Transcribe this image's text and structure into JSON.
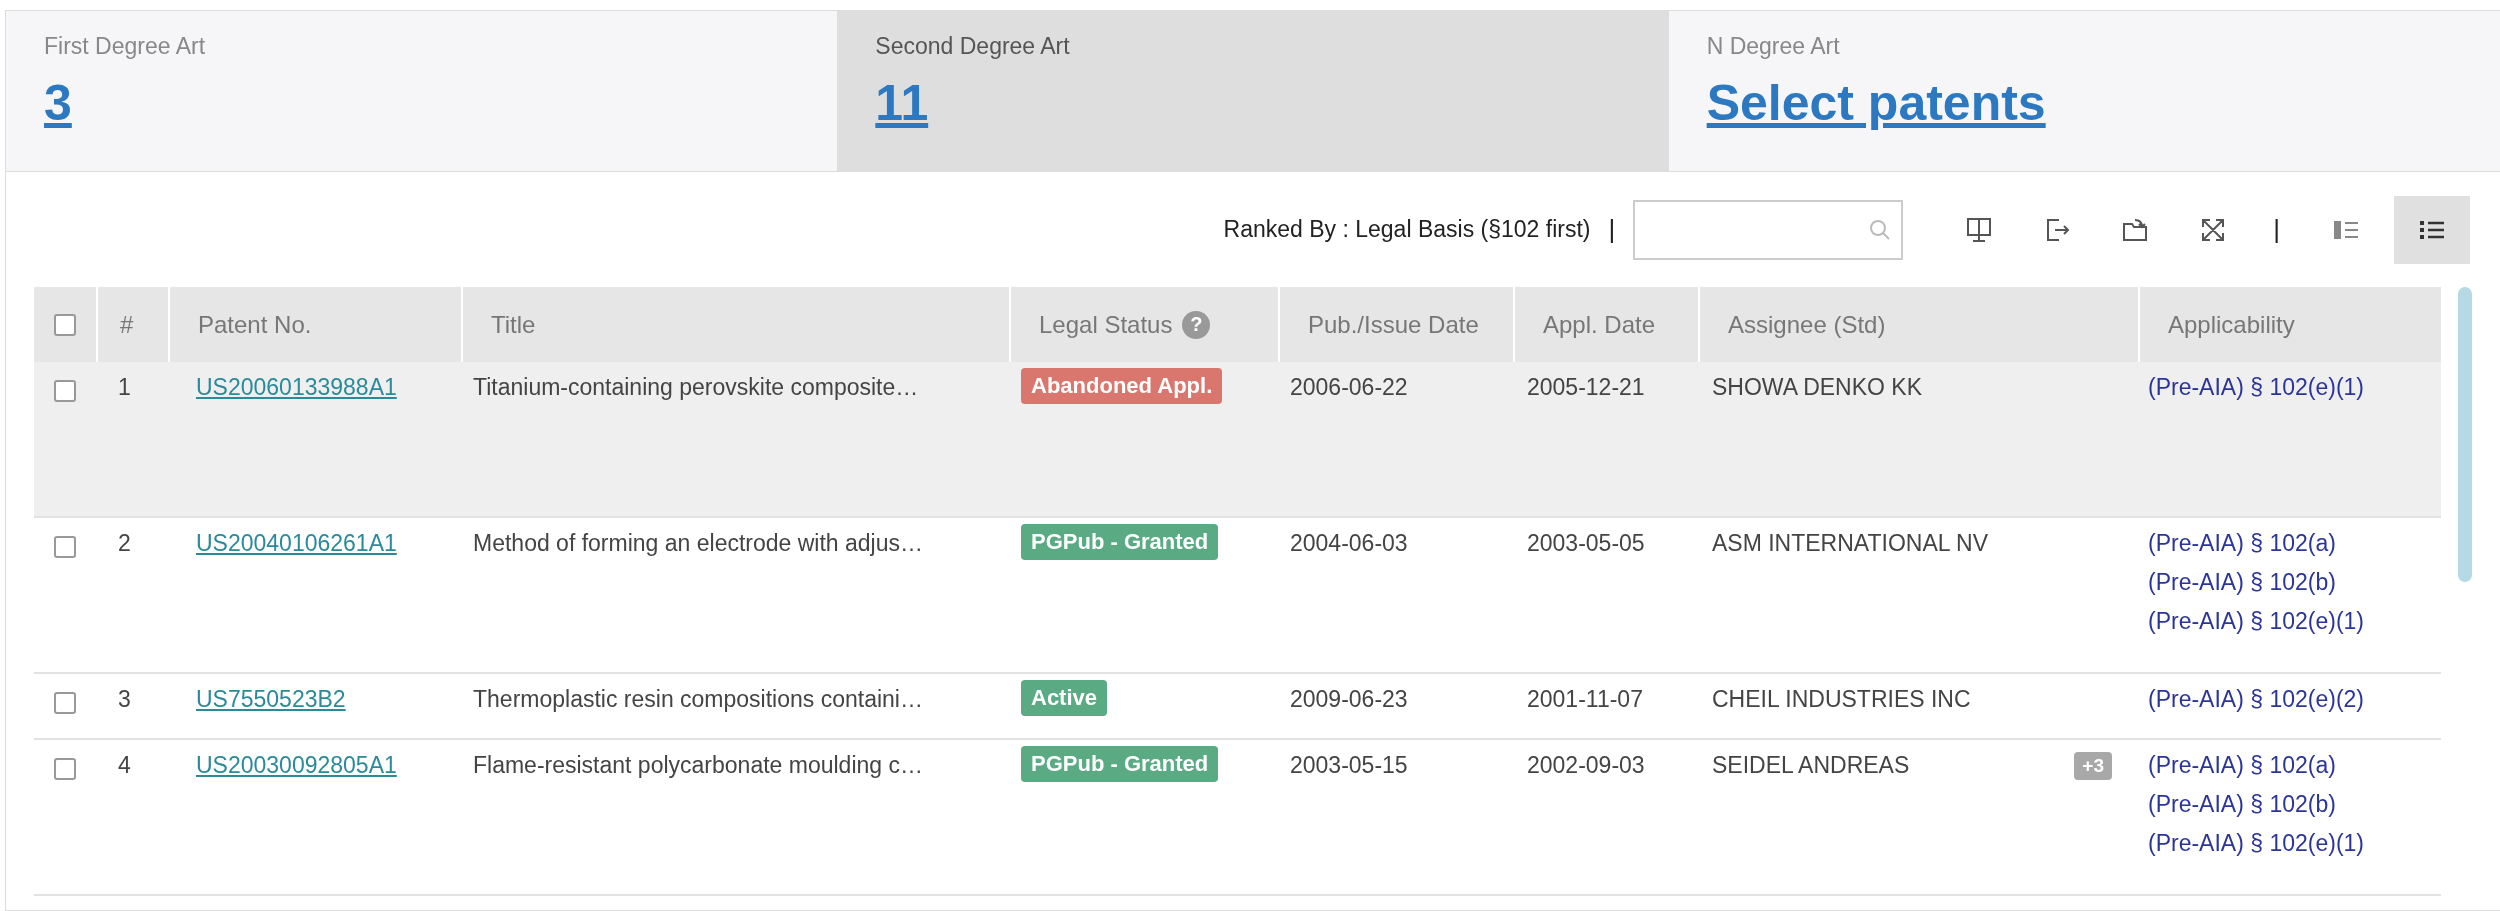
{
  "tabs": [
    {
      "label": "First Degree Art",
      "value": "3",
      "selected": false
    },
    {
      "label": "Second Degree Art",
      "value": "11",
      "selected": true
    },
    {
      "label": "N Degree Art",
      "value": "Select patents",
      "selected": false
    }
  ],
  "toolbar": {
    "ranked_by": "Ranked By : Legal Basis (§102 first)",
    "separator": "|",
    "separator_2": "|",
    "view_buttons": [
      {
        "selected": false
      },
      {
        "selected": true
      }
    ]
  },
  "table": {
    "select_all": {
      "checked": false
    },
    "help_mark": "?",
    "columns": [
      "#",
      "Patent No.",
      "Title",
      "Legal Status",
      "Pub./Issue Date",
      "Appl. Date",
      "Assignee (Std)",
      "Applicability"
    ],
    "rows": [
      {
        "selected": true,
        "checked": false,
        "num": "1",
        "patent": "US20060133988A1",
        "title": "Titanium-containing perovskite composite…",
        "status": {
          "label": "Abandoned Appl.",
          "color": "#d9776e"
        },
        "pub_date": "2006-06-22",
        "appl_date": "2005-12-21",
        "assignee": "SHOWA DENKO KK",
        "applicability": [
          "(Pre-AIA) § 102(e)(1)"
        ]
      },
      {
        "selected": false,
        "checked": false,
        "num": "2",
        "patent": "US20040106261A1",
        "title": "Method of forming an electrode with adjus…",
        "status": {
          "label": "PGPub - Granted",
          "color": "#5aab84"
        },
        "pub_date": "2004-06-03",
        "appl_date": "2003-05-05",
        "assignee": "ASM INTERNATIONAL NV",
        "applicability": [
          "(Pre-AIA) § 102(a)",
          "(Pre-AIA) § 102(b)",
          "(Pre-AIA) § 102(e)(1)"
        ]
      },
      {
        "selected": false,
        "checked": false,
        "num": "3",
        "patent": "US7550523B2",
        "title": "Thermoplastic resin compositions containi…",
        "status": {
          "label": "Active",
          "color": "#5aab84"
        },
        "pub_date": "2009-06-23",
        "appl_date": "2001-11-07",
        "assignee": "CHEIL INDUSTRIES INC",
        "applicability": [
          "(Pre-AIA) § 102(e)(2)"
        ]
      },
      {
        "selected": false,
        "checked": false,
        "num": "4",
        "patent": "US20030092805A1",
        "title": "Flame-resistant polycarbonate moulding c…",
        "status": {
          "label": "PGPub - Granted",
          "color": "#5aab84"
        },
        "pub_date": "2003-05-15",
        "appl_date": "2002-09-03",
        "assignee": "SEIDEL ANDREAS",
        "assignee_more": "+3",
        "applicability": [
          "(Pre-AIA) § 102(a)",
          "(Pre-AIA) § 102(b)",
          "(Pre-AIA) § 102(e)(1)"
        ]
      }
    ]
  }
}
